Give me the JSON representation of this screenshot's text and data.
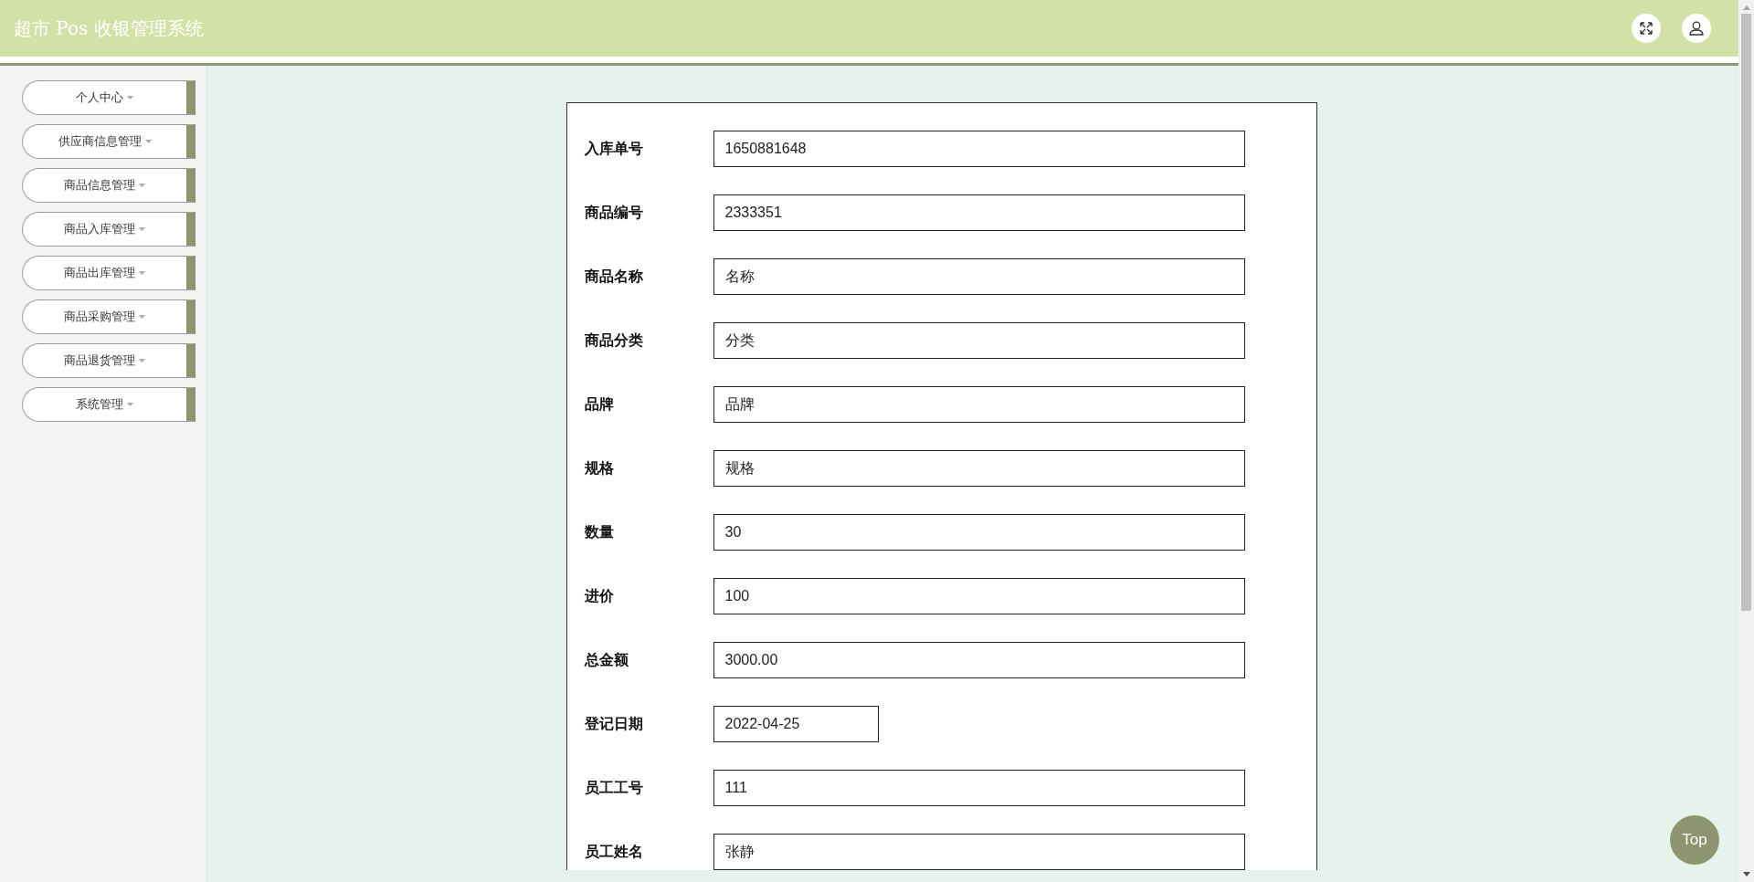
{
  "header": {
    "title": "超市 Pos 收银管理系统"
  },
  "sidebar": {
    "items": [
      {
        "label": "个人中心"
      },
      {
        "label": "供应商信息管理"
      },
      {
        "label": "商品信息管理"
      },
      {
        "label": "商品入库管理"
      },
      {
        "label": "商品出库管理"
      },
      {
        "label": "商品采购管理"
      },
      {
        "label": "商品退货管理"
      },
      {
        "label": "系统管理"
      }
    ]
  },
  "form": {
    "fields": [
      {
        "label": "入库单号",
        "value": "1650881648",
        "kind": "text"
      },
      {
        "label": "商品编号",
        "value": "2333351",
        "kind": "text"
      },
      {
        "label": "商品名称",
        "value": "名称",
        "kind": "text"
      },
      {
        "label": "商品分类",
        "value": "分类",
        "kind": "text"
      },
      {
        "label": "品牌",
        "value": "品牌",
        "kind": "text"
      },
      {
        "label": "规格",
        "value": "规格",
        "kind": "text"
      },
      {
        "label": "数量",
        "value": "30",
        "kind": "text"
      },
      {
        "label": "进价",
        "value": "100",
        "kind": "text"
      },
      {
        "label": "总金额",
        "value": "3000.00",
        "kind": "text"
      },
      {
        "label": "登记日期",
        "value": "2022-04-25",
        "kind": "date"
      },
      {
        "label": "员工工号",
        "value": "111",
        "kind": "text"
      },
      {
        "label": "员工姓名",
        "value": "张静",
        "kind": "text"
      }
    ]
  },
  "top_button": {
    "label": "Top"
  }
}
